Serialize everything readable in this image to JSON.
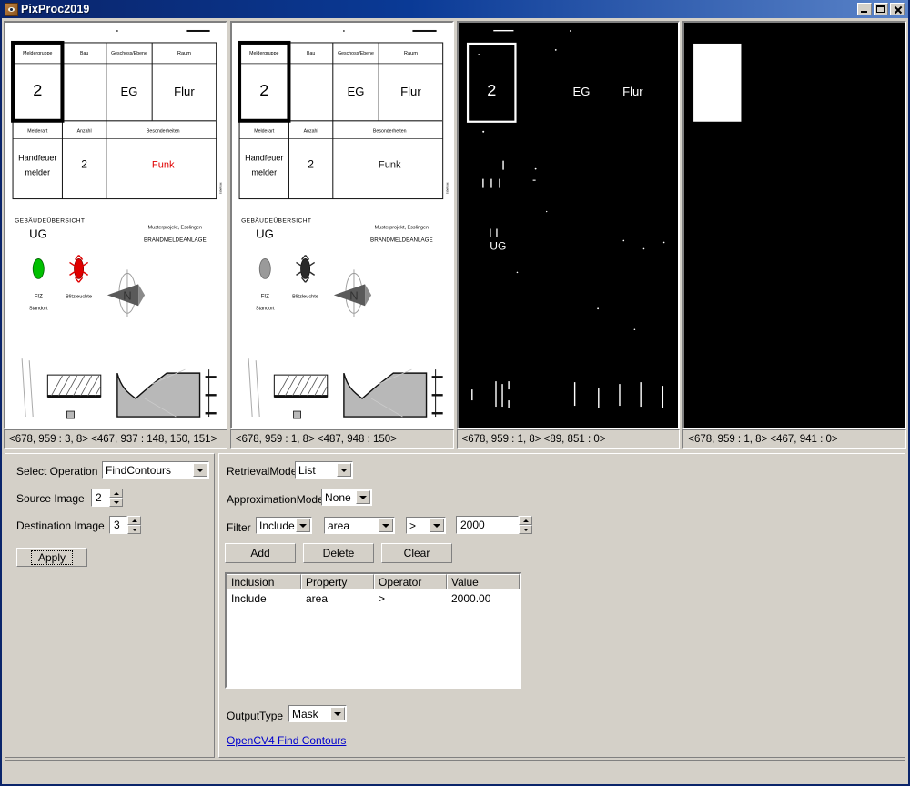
{
  "window": {
    "title": "PixProc2019",
    "icon": "eye-icon",
    "buttons": {
      "minimize": "minimize-icon",
      "maximize": "maximize-icon",
      "close": "close-icon"
    }
  },
  "image_panels": [
    {
      "name": "source-color-image",
      "status": "<678, 959 : 3, 8> <467, 937 : 148, 150, 151>"
    },
    {
      "name": "grayscale-image",
      "status": "<678, 959 : 1, 8> <487, 948 : 150>"
    },
    {
      "name": "contours-image",
      "status": "<678, 959 : 1, 8> <89, 851 : 0>"
    },
    {
      "name": "mask-output-image",
      "status": "<678, 959 : 1, 8> <467, 941 : 0>"
    }
  ],
  "plan": {
    "table_headers_row1": [
      "Meldergruppe",
      "Bau",
      "Geschoss/Ebene",
      "Raum"
    ],
    "table_values_row1": [
      "2",
      "",
      "EG",
      "Flur"
    ],
    "table_headers_row2": [
      "Melderart",
      "Anzahl",
      "Besonderheiten"
    ],
    "table_values_row2": [
      "Handfeuer melder",
      "2",
      "Funk"
    ],
    "overview_label": "GEBÄUDEÜBERSICHT",
    "floor_label": "UG",
    "project_line1": "Musterprojekt, Esslingen",
    "project_line2": "BRANDMELDEANLAGE",
    "legend_green_line1": "FIZ",
    "legend_green_line2": "Standort",
    "legend_red": "Blitzleuchte",
    "color_red": "#e00000",
    "color_green": "#00c000"
  },
  "operation_panel": {
    "select_operation_label": "Select Operation",
    "select_operation_value": "FindContours",
    "source_image_label": "Source Image",
    "source_image_value": "2",
    "destination_image_label": "Destination Image",
    "destination_image_value": "3",
    "apply_label": "Apply"
  },
  "params_panel": {
    "retrieval_mode_label": "RetrievalMode",
    "retrieval_mode_value": "List",
    "approximation_mode_label": "ApproximationMode",
    "approximation_mode_value": "None",
    "filter_label": "Filter",
    "filter_inclusion_value": "Include",
    "filter_property_value": "area",
    "filter_operator_value": ">",
    "filter_value": "2000",
    "add_label": "Add",
    "delete_label": "Delete",
    "clear_label": "Clear",
    "table": {
      "columns": [
        "Inclusion",
        "Property",
        "Operator",
        "Value"
      ],
      "rows": [
        {
          "inclusion": "Include",
          "property": "area",
          "operator": ">",
          "value": "2000.00"
        }
      ]
    },
    "output_type_label": "OutputType",
    "output_type_value": "Mask",
    "doc_link_label": "OpenCV4 Find Contours"
  }
}
